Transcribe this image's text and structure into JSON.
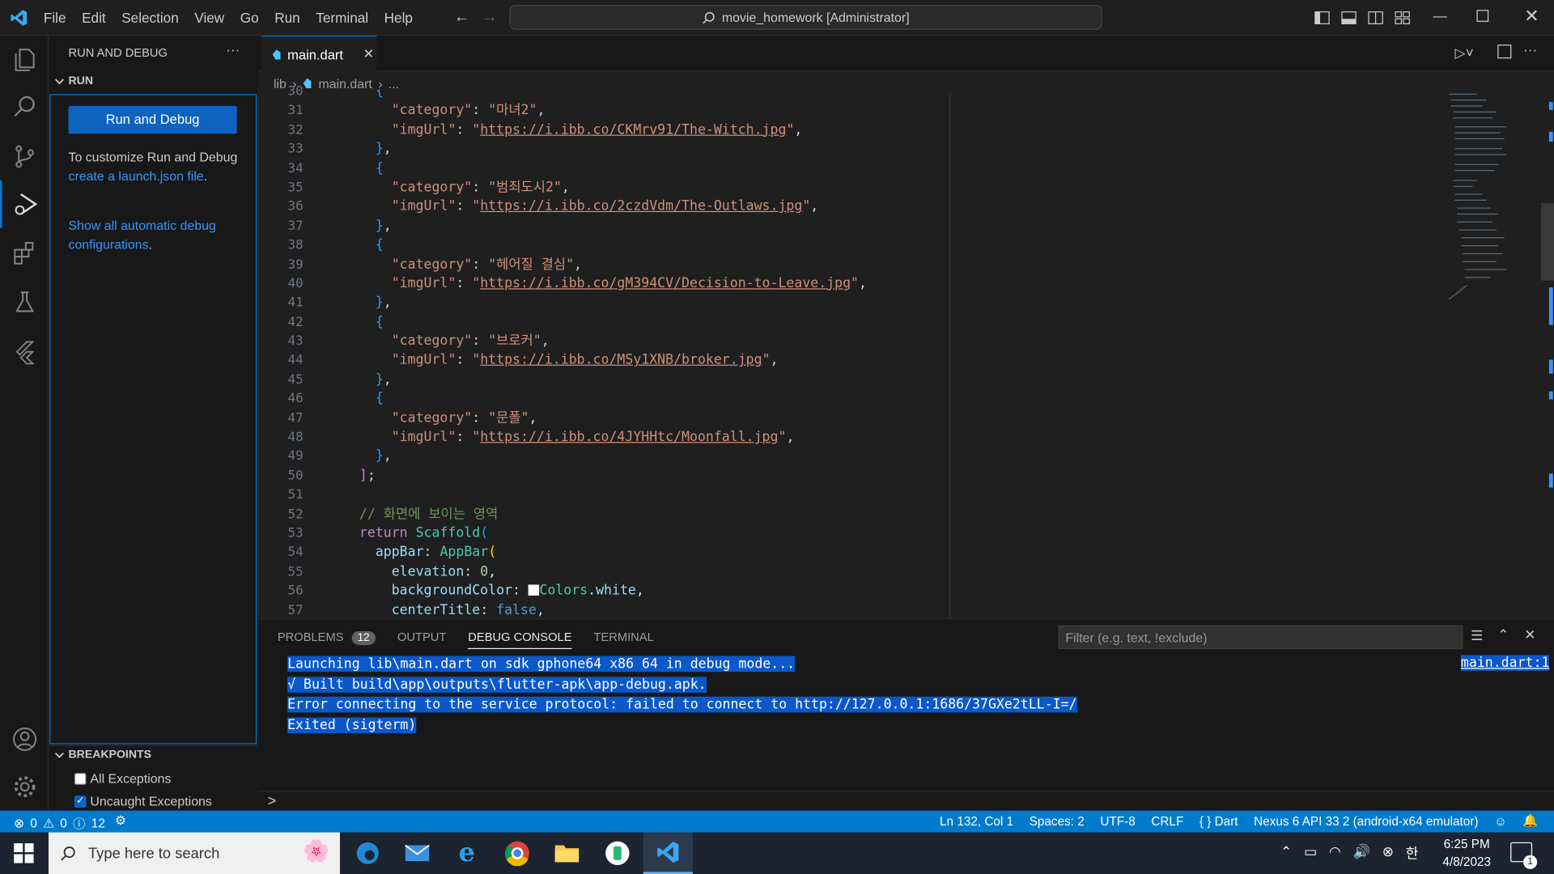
{
  "window": {
    "menu": [
      "File",
      "Edit",
      "Selection",
      "View",
      "Go",
      "Run",
      "Terminal",
      "Help"
    ],
    "command_center": "movie_homework [Administrator]"
  },
  "sidebar": {
    "title": "RUN AND DEBUG",
    "run_section": "RUN",
    "run_button": "Run and Debug",
    "customize_text_1": "To customize Run and Debug ",
    "customize_link": "create a launch.json file",
    "customize_text_2": ".",
    "show_all_link": "Show all automatic debug configurations",
    "show_all_suffix": ".",
    "breakpoints_title": "BREAKPOINTS",
    "bp_all": "All Exceptions",
    "bp_uncaught": "Uncaught Exceptions"
  },
  "editor": {
    "tab": "main.dart",
    "breadcrumb": [
      "lib",
      "main.dart",
      "..."
    ],
    "line_numbers": [
      "30",
      "31",
      "32",
      "33",
      "34",
      "35",
      "36",
      "37",
      "38",
      "39",
      "40",
      "41",
      "42",
      "43",
      "44",
      "45",
      "46",
      "47",
      "48",
      "49",
      "50",
      "51",
      "52",
      "53",
      "54",
      "55",
      "56",
      "57"
    ],
    "items": [
      {
        "category": "마녀2",
        "imgUrl": "https://i.ibb.co/CKMrv91/The-Witch.jpg"
      },
      {
        "category": "범죄도시2",
        "imgUrl": "https://i.ibb.co/2czdVdm/The-Outlaws.jpg"
      },
      {
        "category": "헤어질 결심",
        "imgUrl": "https://i.ibb.co/gM394CV/Decision-to-Leave.jpg"
      },
      {
        "category": "브로커",
        "imgUrl": "https://i.ibb.co/MSy1XNB/broker.jpg"
      },
      {
        "category": "문폴",
        "imgUrl": "https://i.ibb.co/4JYHHtc/Moonfall.jpg"
      }
    ],
    "comment": "// 화면에 보이는 영역"
  },
  "panel": {
    "tabs": [
      "PROBLEMS",
      "OUTPUT",
      "DEBUG CONSOLE",
      "TERMINAL"
    ],
    "problems_count": "12",
    "filter_placeholder": "Filter (e.g. text, !exclude)",
    "source_link": "main.dart:1",
    "console_lines": [
      "Launching lib\\main.dart on sdk gphone64 x86 64 in debug mode...",
      "√  Built build\\app\\outputs\\flutter-apk\\app-debug.apk.",
      "Error connecting to the service protocol: failed to connect to http://127.0.0.1:1686/37GXe2tLL-I=/",
      "Exited (sigterm)"
    ],
    "prompt": ">"
  },
  "status": {
    "errors": "0",
    "warnings": "0",
    "infos": "12",
    "position": "Ln 132, Col 1",
    "spaces": "Spaces: 2",
    "encoding": "UTF-8",
    "eol": "CRLF",
    "language": "Dart",
    "device": "Nexus 6 API 33 2 (android-x64 emulator)"
  },
  "taskbar": {
    "search": "Type here to search",
    "time": "6:25 PM",
    "date": "4/8/2023",
    "notification_count": "1"
  },
  "colors": {
    "accent": "#007acc",
    "button": "#0e63c0",
    "selection": "#0a58ca"
  }
}
